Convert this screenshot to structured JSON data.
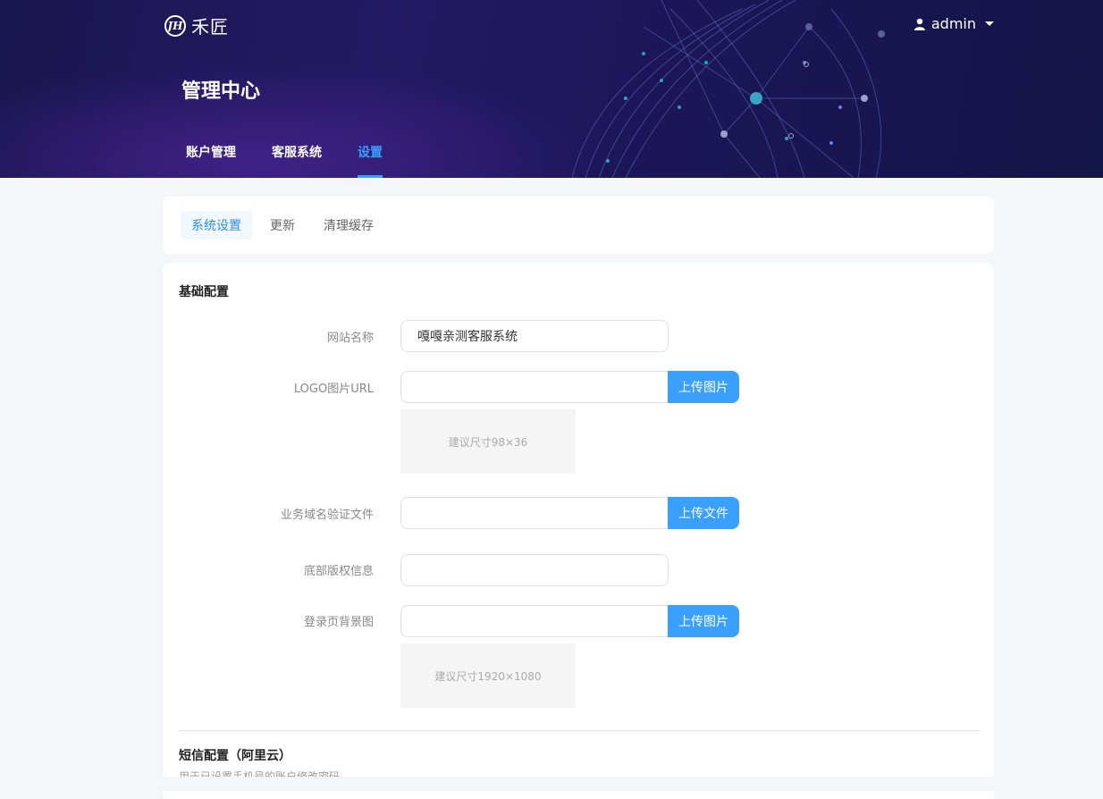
{
  "header": {
    "brand_mark": "JH",
    "brand_name": "禾匠",
    "user_name": "admin",
    "page_title": "管理中心",
    "nav": [
      {
        "label": "账户管理",
        "active": false
      },
      {
        "label": "客服系统",
        "active": false
      },
      {
        "label": "设置",
        "active": true
      }
    ]
  },
  "subnav": {
    "tabs": [
      {
        "label": "系统设置",
        "active": true
      },
      {
        "label": "更新",
        "active": false
      },
      {
        "label": "清理缓存",
        "active": false
      }
    ]
  },
  "form": {
    "section_title": "基础配置",
    "site_name": {
      "label": "网站名称",
      "value": "嘎嘎亲测客服系统"
    },
    "logo_url": {
      "label": "LOGO图片URL",
      "value": "",
      "button": "上传图片",
      "preview_hint": "建议尺寸98×36"
    },
    "domain_verify": {
      "label": "业务域名验证文件",
      "value": "",
      "button": "上传文件"
    },
    "copyright": {
      "label": "底部版权信息",
      "value": ""
    },
    "login_bg": {
      "label": "登录页背景图",
      "value": "",
      "button": "上传图片",
      "preview_hint": "建议尺寸1920×1080"
    },
    "sms_section_title": "短信配置（阿里云）",
    "sms_section_desc": "用于已设置手机号的账户修改密码"
  },
  "colors": {
    "accent": "#3aa0ff",
    "hero_bg": "#1c1657"
  }
}
